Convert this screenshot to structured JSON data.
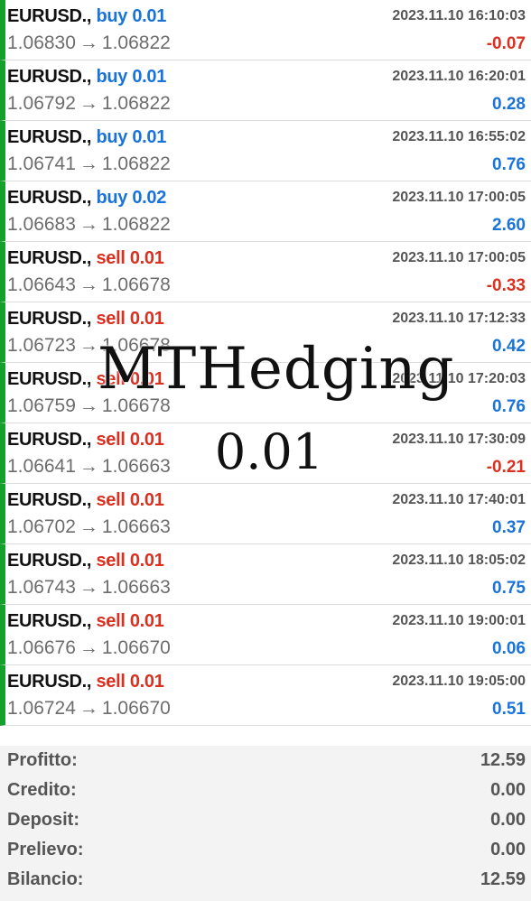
{
  "trades": [
    {
      "symbol": "EURUSD.,",
      "type_lot": "buy 0.01",
      "side": "buy",
      "time": "2023.11.10 16:10:03",
      "open": "1.06830",
      "close": "1.06822",
      "profit": "-0.07"
    },
    {
      "symbol": "EURUSD.,",
      "type_lot": "buy 0.01",
      "side": "buy",
      "time": "2023.11.10 16:20:01",
      "open": "1.06792",
      "close": "1.06822",
      "profit": "0.28"
    },
    {
      "symbol": "EURUSD.,",
      "type_lot": "buy 0.01",
      "side": "buy",
      "time": "2023.11.10 16:55:02",
      "open": "1.06741",
      "close": "1.06822",
      "profit": "0.76"
    },
    {
      "symbol": "EURUSD.,",
      "type_lot": "buy 0.02",
      "side": "buy",
      "time": "2023.11.10 17:00:05",
      "open": "1.06683",
      "close": "1.06822",
      "profit": "2.60"
    },
    {
      "symbol": "EURUSD.,",
      "type_lot": "sell 0.01",
      "side": "sell",
      "time": "2023.11.10 17:00:05",
      "open": "1.06643",
      "close": "1.06678",
      "profit": "-0.33"
    },
    {
      "symbol": "EURUSD.,",
      "type_lot": "sell 0.01",
      "side": "sell",
      "time": "2023.11.10 17:12:33",
      "open": "1.06723",
      "close": "1.06678",
      "profit": "0.42"
    },
    {
      "symbol": "EURUSD.,",
      "type_lot": "sell 0.01",
      "side": "sell",
      "time": "2023.11.10 17:20:03",
      "open": "1.06759",
      "close": "1.06678",
      "profit": "0.76"
    },
    {
      "symbol": "EURUSD.,",
      "type_lot": "sell 0.01",
      "side": "sell",
      "time": "2023.11.10 17:30:09",
      "open": "1.06641",
      "close": "1.06663",
      "profit": "-0.21"
    },
    {
      "symbol": "EURUSD.,",
      "type_lot": "sell 0.01",
      "side": "sell",
      "time": "2023.11.10 17:40:01",
      "open": "1.06702",
      "close": "1.06663",
      "profit": "0.37"
    },
    {
      "symbol": "EURUSD.,",
      "type_lot": "sell 0.01",
      "side": "sell",
      "time": "2023.11.10 18:05:02",
      "open": "1.06743",
      "close": "1.06663",
      "profit": "0.75"
    },
    {
      "symbol": "EURUSD.,",
      "type_lot": "sell 0.01",
      "side": "sell",
      "time": "2023.11.10 19:00:01",
      "open": "1.06676",
      "close": "1.06670",
      "profit": "0.06"
    },
    {
      "symbol": "EURUSD.,",
      "type_lot": "sell 0.01",
      "side": "sell",
      "time": "2023.11.10 19:05:00",
      "open": "1.06724",
      "close": "1.06670",
      "profit": "0.51"
    }
  ],
  "arrow": "→",
  "summary": [
    {
      "label": "Profitto:",
      "value": "12.59"
    },
    {
      "label": "Credito:",
      "value": "0.00"
    },
    {
      "label": "Deposit:",
      "value": "0.00"
    },
    {
      "label": "Prelievo:",
      "value": "0.00"
    },
    {
      "label": "Bilancio:",
      "value": "12.59"
    }
  ],
  "watermark": {
    "line1": "MTHedging",
    "line2": "0.01"
  },
  "colors": {
    "buy": "#1a74d8",
    "sell": "#d93020",
    "profit_positive": "#1a74d8",
    "profit_negative": "#d93020",
    "row_accent": "#14a02d"
  }
}
